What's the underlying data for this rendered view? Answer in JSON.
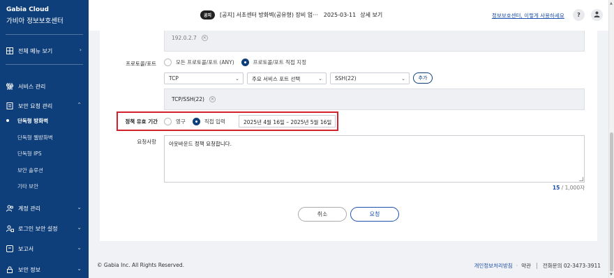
{
  "sidebar": {
    "brand_en": "Gabia Cloud",
    "brand_ko": "가비아 정보보호센터",
    "menu_all": "전체 메뉴 보기",
    "service": "서비스 관리",
    "security_request": "보안 요청 관리",
    "sub_items": [
      "단독형 방화벽",
      "단독형 웹방화벽",
      "단독형 IPS",
      "보안 솔루션",
      "기타 보안"
    ],
    "account": "계정 관리",
    "login_security": "로그인 보안 설정",
    "report": "보고서",
    "security_info": "보안 정보"
  },
  "topbar": {
    "notice_badge": "공지",
    "notice_text": "[공지] 서초센터 방화벽(공유형) 장비 업···",
    "notice_date": "2025-03-11",
    "notice_more": "상세 보기",
    "help_link": "정보보호센터, 이렇게 사용하세요",
    "help_icon": "?"
  },
  "form": {
    "ip_chip": "192.0.2.7",
    "protocol_label": "프로토콜/포트",
    "radio_any": "모든 프로토콜/포트 (ANY)",
    "radio_direct": "프로토콜/포트 직접 지정",
    "select_protocol": "TCP",
    "select_service": "주요 서비스 포트 선택",
    "select_port": "SSH(22)",
    "add_button": "추가",
    "proto_chip": "TCP/SSH(22)",
    "period_label": "정책 유효 기간",
    "radio_permanent": "영구",
    "radio_manual": "직접 입력",
    "date_range": "2025년 4월 16일 – 2025년 5월 16일",
    "request_label": "요청사항",
    "request_text": "아웃바운드 정책 요청합니다.",
    "char_count": "15",
    "char_max": " / 1,000자",
    "cancel_button": "취소",
    "submit_button": "요청"
  },
  "footer": {
    "copyright": "© Gabia Inc. All Rights Reserved.",
    "privacy": "개인정보처리방침",
    "dot": "·",
    "terms": "약관",
    "phone": "전화문의 02-3473-3911"
  },
  "colors": {
    "sidebar_bg": "#0f3f7a",
    "accent": "#1a4fae",
    "highlight_border": "#d4202a"
  }
}
